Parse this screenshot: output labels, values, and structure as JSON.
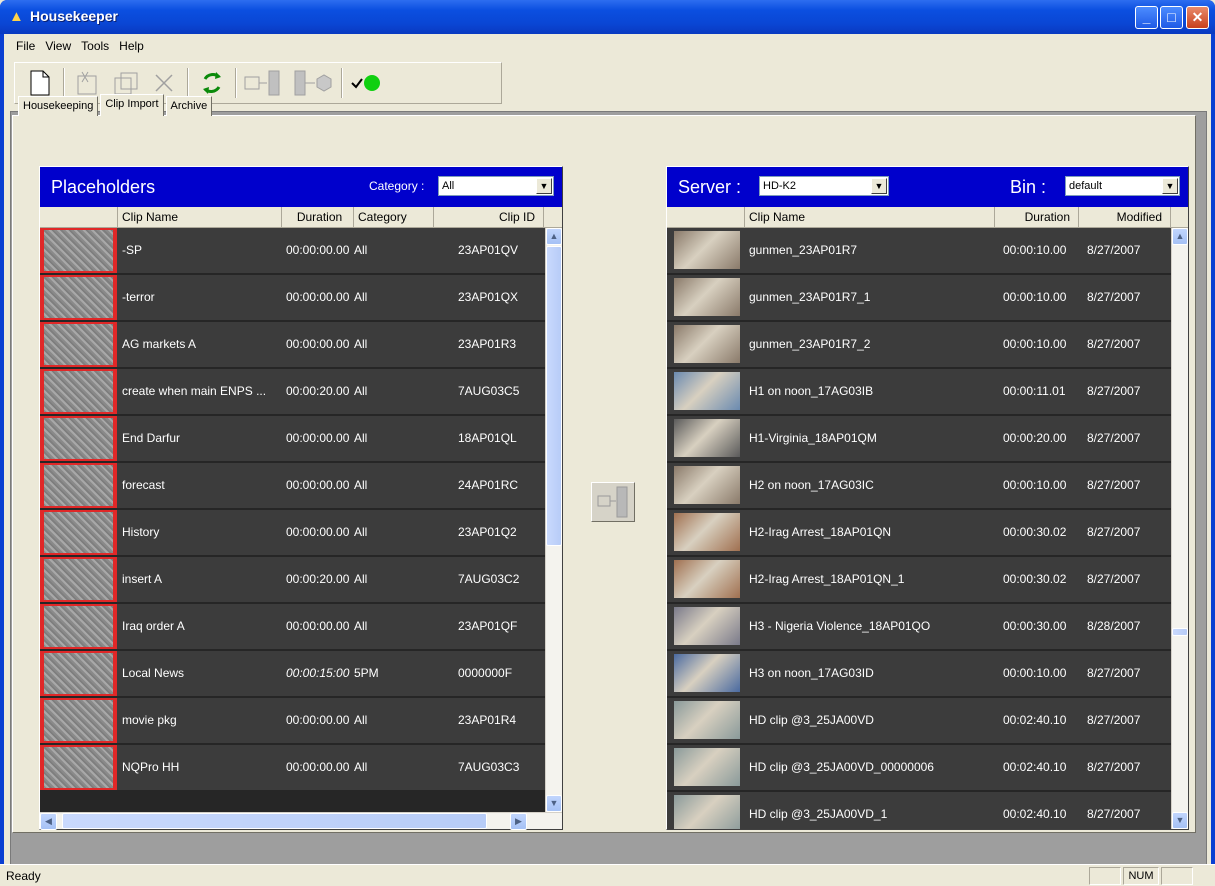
{
  "app": {
    "title": "Housekeeper",
    "minimize": "_",
    "maximize": "□",
    "close": "✕"
  },
  "menu": [
    "File",
    "View",
    "Tools",
    "Help"
  ],
  "toolbar": {
    "icons": [
      "new-document-icon",
      "cut-clip-icon",
      "copy-clip-icon",
      "delete-icon",
      "refresh-icon",
      "import-bin-icon",
      "export-cube-icon",
      "connection-status-icon"
    ]
  },
  "tabs": [
    {
      "label": "Housekeeping",
      "active": false
    },
    {
      "label": "Clip Import",
      "active": true
    },
    {
      "label": "Archive",
      "active": false
    }
  ],
  "placeholders": {
    "title": "Placeholders",
    "category_label": "Category :",
    "category_value": "All",
    "columns": [
      "Clip Name",
      "Duration",
      "Category",
      "Clip ID"
    ],
    "rows": [
      {
        "name": "-SP",
        "duration": "00:00:00.00",
        "category": "All",
        "clip_id": "23AP01QV"
      },
      {
        "name": "-terror",
        "duration": "00:00:00.00",
        "category": "All",
        "clip_id": "23AP01QX"
      },
      {
        "name": "AG markets A",
        "duration": "00:00:00.00",
        "category": "All",
        "clip_id": "23AP01R3"
      },
      {
        "name": "create when main ENPS ...",
        "duration": "00:00:20.00",
        "category": "All",
        "clip_id": "7AUG03C5"
      },
      {
        "name": "End Darfur",
        "duration": "00:00:00.00",
        "category": "All",
        "clip_id": "18AP01QL"
      },
      {
        "name": "forecast",
        "duration": "00:00:00.00",
        "category": "All",
        "clip_id": "24AP01RC"
      },
      {
        "name": "History",
        "duration": "00:00:00.00",
        "category": "All",
        "clip_id": "23AP01Q2"
      },
      {
        "name": "insert A",
        "duration": "00:00:20.00",
        "category": "All",
        "clip_id": "7AUG03C2"
      },
      {
        "name": "Iraq order A",
        "duration": "00:00:00.00",
        "category": "All",
        "clip_id": "23AP01QF"
      },
      {
        "name": "Local News",
        "duration": "00:00:15:00",
        "category": "5PM",
        "clip_id": "0000000F"
      },
      {
        "name": "movie pkg",
        "duration": "00:00:00.00",
        "category": "All",
        "clip_id": "23AP01R4"
      },
      {
        "name": "NQPro HH",
        "duration": "00:00:00.00",
        "category": "All",
        "clip_id": "7AUG03C3"
      }
    ]
  },
  "server": {
    "server_label": "Server :",
    "server_value": "HD-K2",
    "bin_label": "Bin :",
    "bin_value": "default",
    "columns": [
      "Clip Name",
      "Duration",
      "Modified"
    ],
    "rows": [
      {
        "name": "gunmen_23AP01R7",
        "duration": "00:00:10.00",
        "modified": "8/27/2007",
        "thumb": "#8a7a6a"
      },
      {
        "name": "gunmen_23AP01R7_1",
        "duration": "00:00:10.00",
        "modified": "8/27/2007",
        "thumb": "#8a7a6a"
      },
      {
        "name": "gunmen_23AP01R7_2",
        "duration": "00:00:10.00",
        "modified": "8/27/2007",
        "thumb": "#8a7a6a"
      },
      {
        "name": "H1 on noon_17AG03IB",
        "duration": "00:00:11.01",
        "modified": "8/27/2007",
        "thumb": "#6a8ab0"
      },
      {
        "name": "H1-Virginia_18AP01QM",
        "duration": "00:00:20.00",
        "modified": "8/27/2007",
        "thumb": "#5a5a5a"
      },
      {
        "name": "H2 on noon_17AG03IC",
        "duration": "00:00:10.00",
        "modified": "8/27/2007",
        "thumb": "#8a7a6a"
      },
      {
        "name": "H2-Irag Arrest_18AP01QN",
        "duration": "00:00:30.02",
        "modified": "8/27/2007",
        "thumb": "#a07050"
      },
      {
        "name": "H2-Irag Arrest_18AP01QN_1",
        "duration": "00:00:30.02",
        "modified": "8/27/2007",
        "thumb": "#a07050"
      },
      {
        "name": "H3 - Nigeria Violence_18AP01QO",
        "duration": "00:00:30.00",
        "modified": "8/28/2007",
        "thumb": "#7a7a8a"
      },
      {
        "name": "H3 on noon_17AG03ID",
        "duration": "00:00:10.00",
        "modified": "8/27/2007",
        "thumb": "#4a6aa0"
      },
      {
        "name": "HD clip @3_25JA00VD",
        "duration": "00:02:40.10",
        "modified": "8/27/2007",
        "thumb": "#8a9a9a"
      },
      {
        "name": "HD clip @3_25JA00VD_00000006",
        "duration": "00:02:40.10",
        "modified": "8/27/2007",
        "thumb": "#8a9a9a"
      },
      {
        "name": "HD clip @3_25JA00VD_1",
        "duration": "00:02:40.10",
        "modified": "8/27/2007",
        "thumb": "#8a9a9a"
      }
    ]
  },
  "status": {
    "text": "Ready",
    "num": "NUM"
  }
}
